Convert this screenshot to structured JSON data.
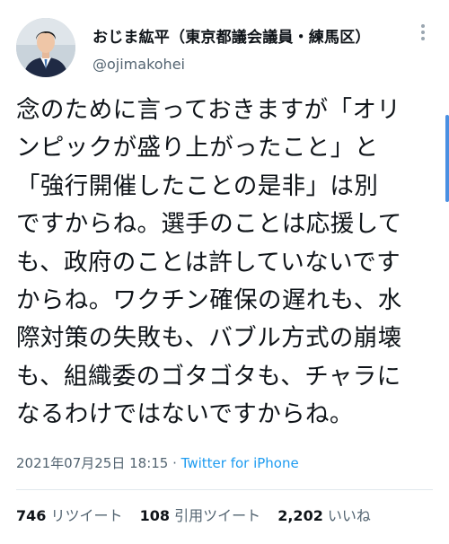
{
  "author": {
    "display_name": "おじま紘平（東京都議会議員・練馬区）",
    "handle": "@ojimakohei"
  },
  "more_icon": "more-vertical-icon",
  "body_lines": [
    "念のために言っておきますが「オリ",
    "ンピックが盛り上がったこと」と",
    "「強行開催したことの是非」は別",
    "ですからね。選手のことは応援して",
    "も、政府のことは許していないです",
    "からね。ワクチン確保の遅れも、水",
    "際対策の失敗も、バブル方式の崩壊",
    "も、組織委のゴタゴタも、チャラに",
    "なるわけではないですからね。"
  ],
  "meta": {
    "timestamp": "2021年07月25日 18:15",
    "separator": " · ",
    "source": "Twitter for iPhone"
  },
  "stats": {
    "retweets": {
      "count": "746",
      "label": "リツイート"
    },
    "quotes": {
      "count": "108",
      "label": "引用ツイート"
    },
    "likes": {
      "count": "2,202",
      "label": "いいね"
    }
  },
  "colors": {
    "text": "#0f1419",
    "secondary": "#536471",
    "link": "#1d9bf0",
    "divider": "#e1e8ed",
    "scroll_thumb": "#4a90e2"
  }
}
